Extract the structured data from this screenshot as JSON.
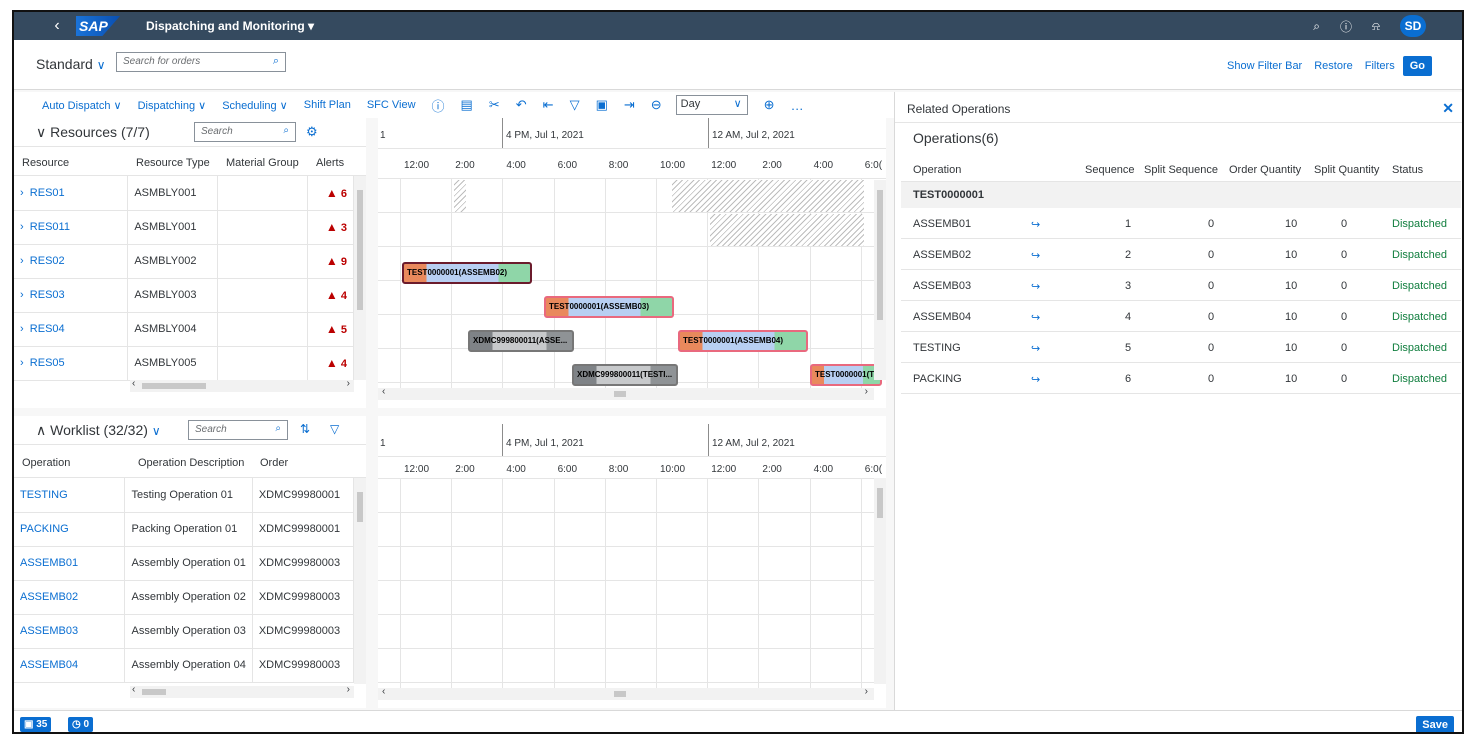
{
  "shell": {
    "title": "Dispatching and Monitoring",
    "initials": "SD",
    "logo": "SAP"
  },
  "filterbar": {
    "variant": "Standard",
    "search_placeholder": "Search for orders",
    "show_filter_bar": "Show Filter Bar",
    "restore": "Restore",
    "filters": "Filters",
    "go": "Go"
  },
  "toolbar": {
    "auto_dispatch": "Auto Dispatch",
    "dispatching": "Dispatching",
    "scheduling": "Scheduling",
    "shift_plan": "Shift Plan",
    "sfc_view": "SFC View",
    "zoom_level": "Day"
  },
  "resources": {
    "title": "Resources (7/7)",
    "search_placeholder": "Search",
    "columns": [
      "Resource",
      "Resource Type",
      "Material Group",
      "Alerts"
    ],
    "rows": [
      {
        "id": "RES01",
        "type": "ASMBLY001",
        "group": "",
        "alerts": "6"
      },
      {
        "id": "RES011",
        "type": "ASMBLY001",
        "group": "",
        "alerts": "3"
      },
      {
        "id": "RES02",
        "type": "ASMBLY002",
        "group": "",
        "alerts": "9"
      },
      {
        "id": "RES03",
        "type": "ASMBLY003",
        "group": "",
        "alerts": "4"
      },
      {
        "id": "RES04",
        "type": "ASMBLY004",
        "group": "",
        "alerts": "5"
      },
      {
        "id": "RES05",
        "type": "ASMBLY005",
        "group": "",
        "alerts": "4"
      }
    ]
  },
  "worklist": {
    "title": "Worklist (32/32)",
    "search_placeholder": "Search",
    "columns": [
      "Operation",
      "Operation Description",
      "Order"
    ],
    "rows": [
      {
        "op": "TESTING",
        "desc": "Testing Operation 01",
        "order": "XDMC99980001"
      },
      {
        "op": "PACKING",
        "desc": "Packing Operation 01",
        "order": "XDMC99980001"
      },
      {
        "op": "ASSEMB01",
        "desc": "Assembly Operation 01",
        "order": "XDMC99980003"
      },
      {
        "op": "ASSEMB02",
        "desc": "Assembly Operation 02",
        "order": "XDMC99980003"
      },
      {
        "op": "ASSEMB03",
        "desc": "Assembly Operation 03",
        "order": "XDMC99980003"
      },
      {
        "op": "ASSEMB04",
        "desc": "Assembly Operation 04",
        "order": "XDMC99980003"
      }
    ]
  },
  "timeline": {
    "major_left": "1",
    "major_1": "4 PM, Jul 1, 2021",
    "major_2": "12 AM, Jul 2, 2021",
    "hours": [
      "12:00",
      "2:00",
      "4:00",
      "6:00",
      "8:00",
      "10:00",
      "12:00",
      "2:00",
      "4:00",
      "6:0("
    ]
  },
  "gantt_bars": [
    {
      "label": "TEST0000001(ASSEMB02)"
    },
    {
      "label": "TEST0000001(ASSEMB03)"
    },
    {
      "label": "XDMC999800011(ASSE..."
    },
    {
      "label": "TEST0000001(ASSEMB04)"
    },
    {
      "label": "XDMC999800011(TESTI..."
    },
    {
      "label": "TEST0000001(T"
    }
  ],
  "related": {
    "title": "Related Operations",
    "subtitle": "Operations(6)",
    "columns": [
      "Operation",
      "Sequence",
      "Split Sequence",
      "Order Quantity",
      "Split Quantity",
      "Status"
    ],
    "group": "TEST0000001",
    "rows": [
      {
        "op": "ASSEMB01",
        "seq": "1",
        "split_seq": "0",
        "qty": "10",
        "split_qty": "0",
        "status": "Dispatched"
      },
      {
        "op": "ASSEMB02",
        "seq": "2",
        "split_seq": "0",
        "qty": "10",
        "split_qty": "0",
        "status": "Dispatched"
      },
      {
        "op": "ASSEMB03",
        "seq": "3",
        "split_seq": "0",
        "qty": "10",
        "split_qty": "0",
        "status": "Dispatched"
      },
      {
        "op": "ASSEMB04",
        "seq": "4",
        "split_seq": "0",
        "qty": "10",
        "split_qty": "0",
        "status": "Dispatched"
      },
      {
        "op": "TESTING",
        "seq": "5",
        "split_seq": "0",
        "qty": "10",
        "split_qty": "0",
        "status": "Dispatched"
      },
      {
        "op": "PACKING",
        "seq": "6",
        "split_seq": "0",
        "qty": "10",
        "split_qty": "0",
        "status": "Dispatched"
      }
    ]
  },
  "footer": {
    "messages": "35",
    "pending": "0",
    "save": "Save"
  },
  "colors": {
    "shell": "#354a5f",
    "accent": "#0a6ed1",
    "alert": "#bb0000",
    "success": "#107e3e"
  }
}
